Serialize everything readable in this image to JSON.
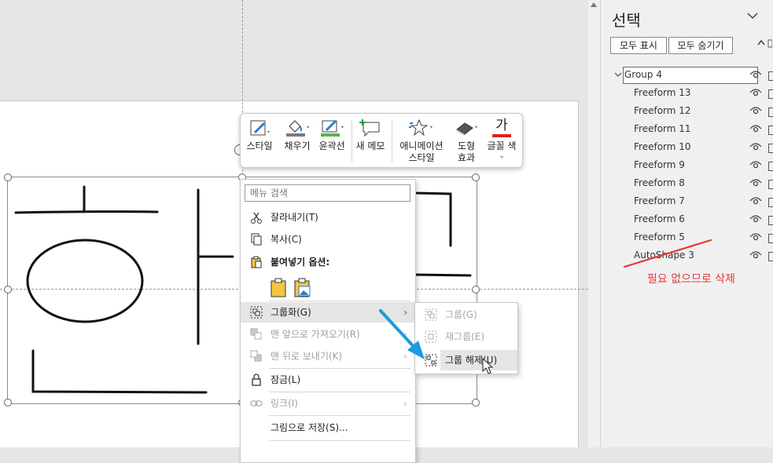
{
  "mini_toolbar": {
    "style": "스타일",
    "fill": "채우기",
    "outline": "윤곽선",
    "new_comment": "새 메모",
    "animation_line1": "애니메이션",
    "animation_line2": "스타일",
    "effects_line1": "도형",
    "effects_line2": "효과",
    "font_color": "글꼴 색",
    "font_color_glyph": "가",
    "colors": {
      "fill": "#7a7a7a",
      "outline": "#5fb04a",
      "font": "#e02020",
      "comment_plus": "#2e9a3e"
    }
  },
  "context_menu": {
    "search_placeholder": "메뉴 검색",
    "items": {
      "cut": "잘라내기(T)",
      "copy": "복사(C)",
      "paste_options": "붙여넣기 옵션:",
      "group": "그룹화(G)",
      "bring_front": "맨 앞으로 가져오기(R)",
      "send_back": "맨 뒤로 보내기(K)",
      "lock": "잠금(L)",
      "link": "링크(I)",
      "save_as_picture": "그림으로 저장(S)..."
    },
    "arrow": "›"
  },
  "submenu": {
    "group": "그룹(G)",
    "regroup": "재그룹(E)",
    "ungroup": "그룹 해제(U)"
  },
  "selection_pane": {
    "title": "선택",
    "show_all": "모두 표시",
    "hide_all": "모두 숨기기",
    "group_name": "Group 4",
    "items": [
      "Freeform 13",
      "Freeform 12",
      "Freeform 11",
      "Freeform 10",
      "Freeform 9",
      "Freeform 8",
      "Freeform 7",
      "Freeform 6",
      "Freeform 5",
      "AutoShape 3"
    ]
  },
  "annotation": {
    "text": "필요 없으므로 삭제",
    "color": "#e53935",
    "arrow_color": "#1a9be0"
  }
}
